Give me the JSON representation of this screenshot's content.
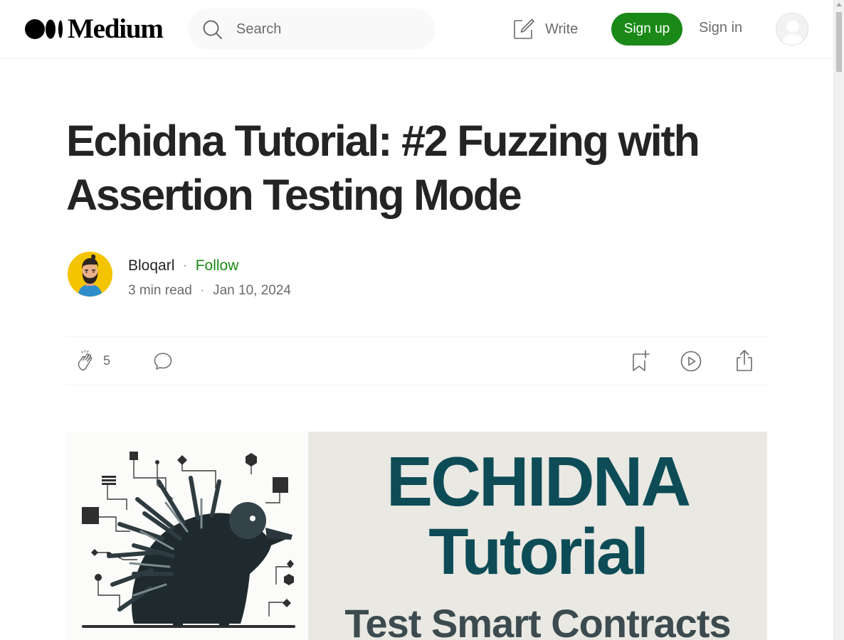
{
  "header": {
    "logo_text": "Medium",
    "search": {
      "placeholder": "Search",
      "value": ""
    },
    "write_label": "Write",
    "signup_label": "Sign up",
    "signin_label": "Sign in"
  },
  "article": {
    "title": "Echidna Tutorial: #2 Fuzzing with Assertion Testing Mode",
    "author": {
      "name": "Bloqarl",
      "follow_label": "Follow"
    },
    "meta": {
      "read_time": "3 min read",
      "date": "Jan 10, 2024"
    },
    "actions": {
      "clap_count": "5"
    },
    "hero": {
      "line1": "ECHIDNA",
      "line2": "Tutorial",
      "line3": "Test Smart Contracts"
    }
  },
  "colors": {
    "accent_green": "#1a8917",
    "text_primary": "#242424",
    "text_secondary": "#6b6b6b",
    "hero_teal": "#0d4c57",
    "avatar_bg": "#f5c400"
  },
  "icons": [
    "medium-logo-icon",
    "search-icon",
    "write-icon",
    "user-avatar-icon",
    "clap-icon",
    "response-icon",
    "bookmark-add-icon",
    "listen-play-icon",
    "share-icon"
  ]
}
